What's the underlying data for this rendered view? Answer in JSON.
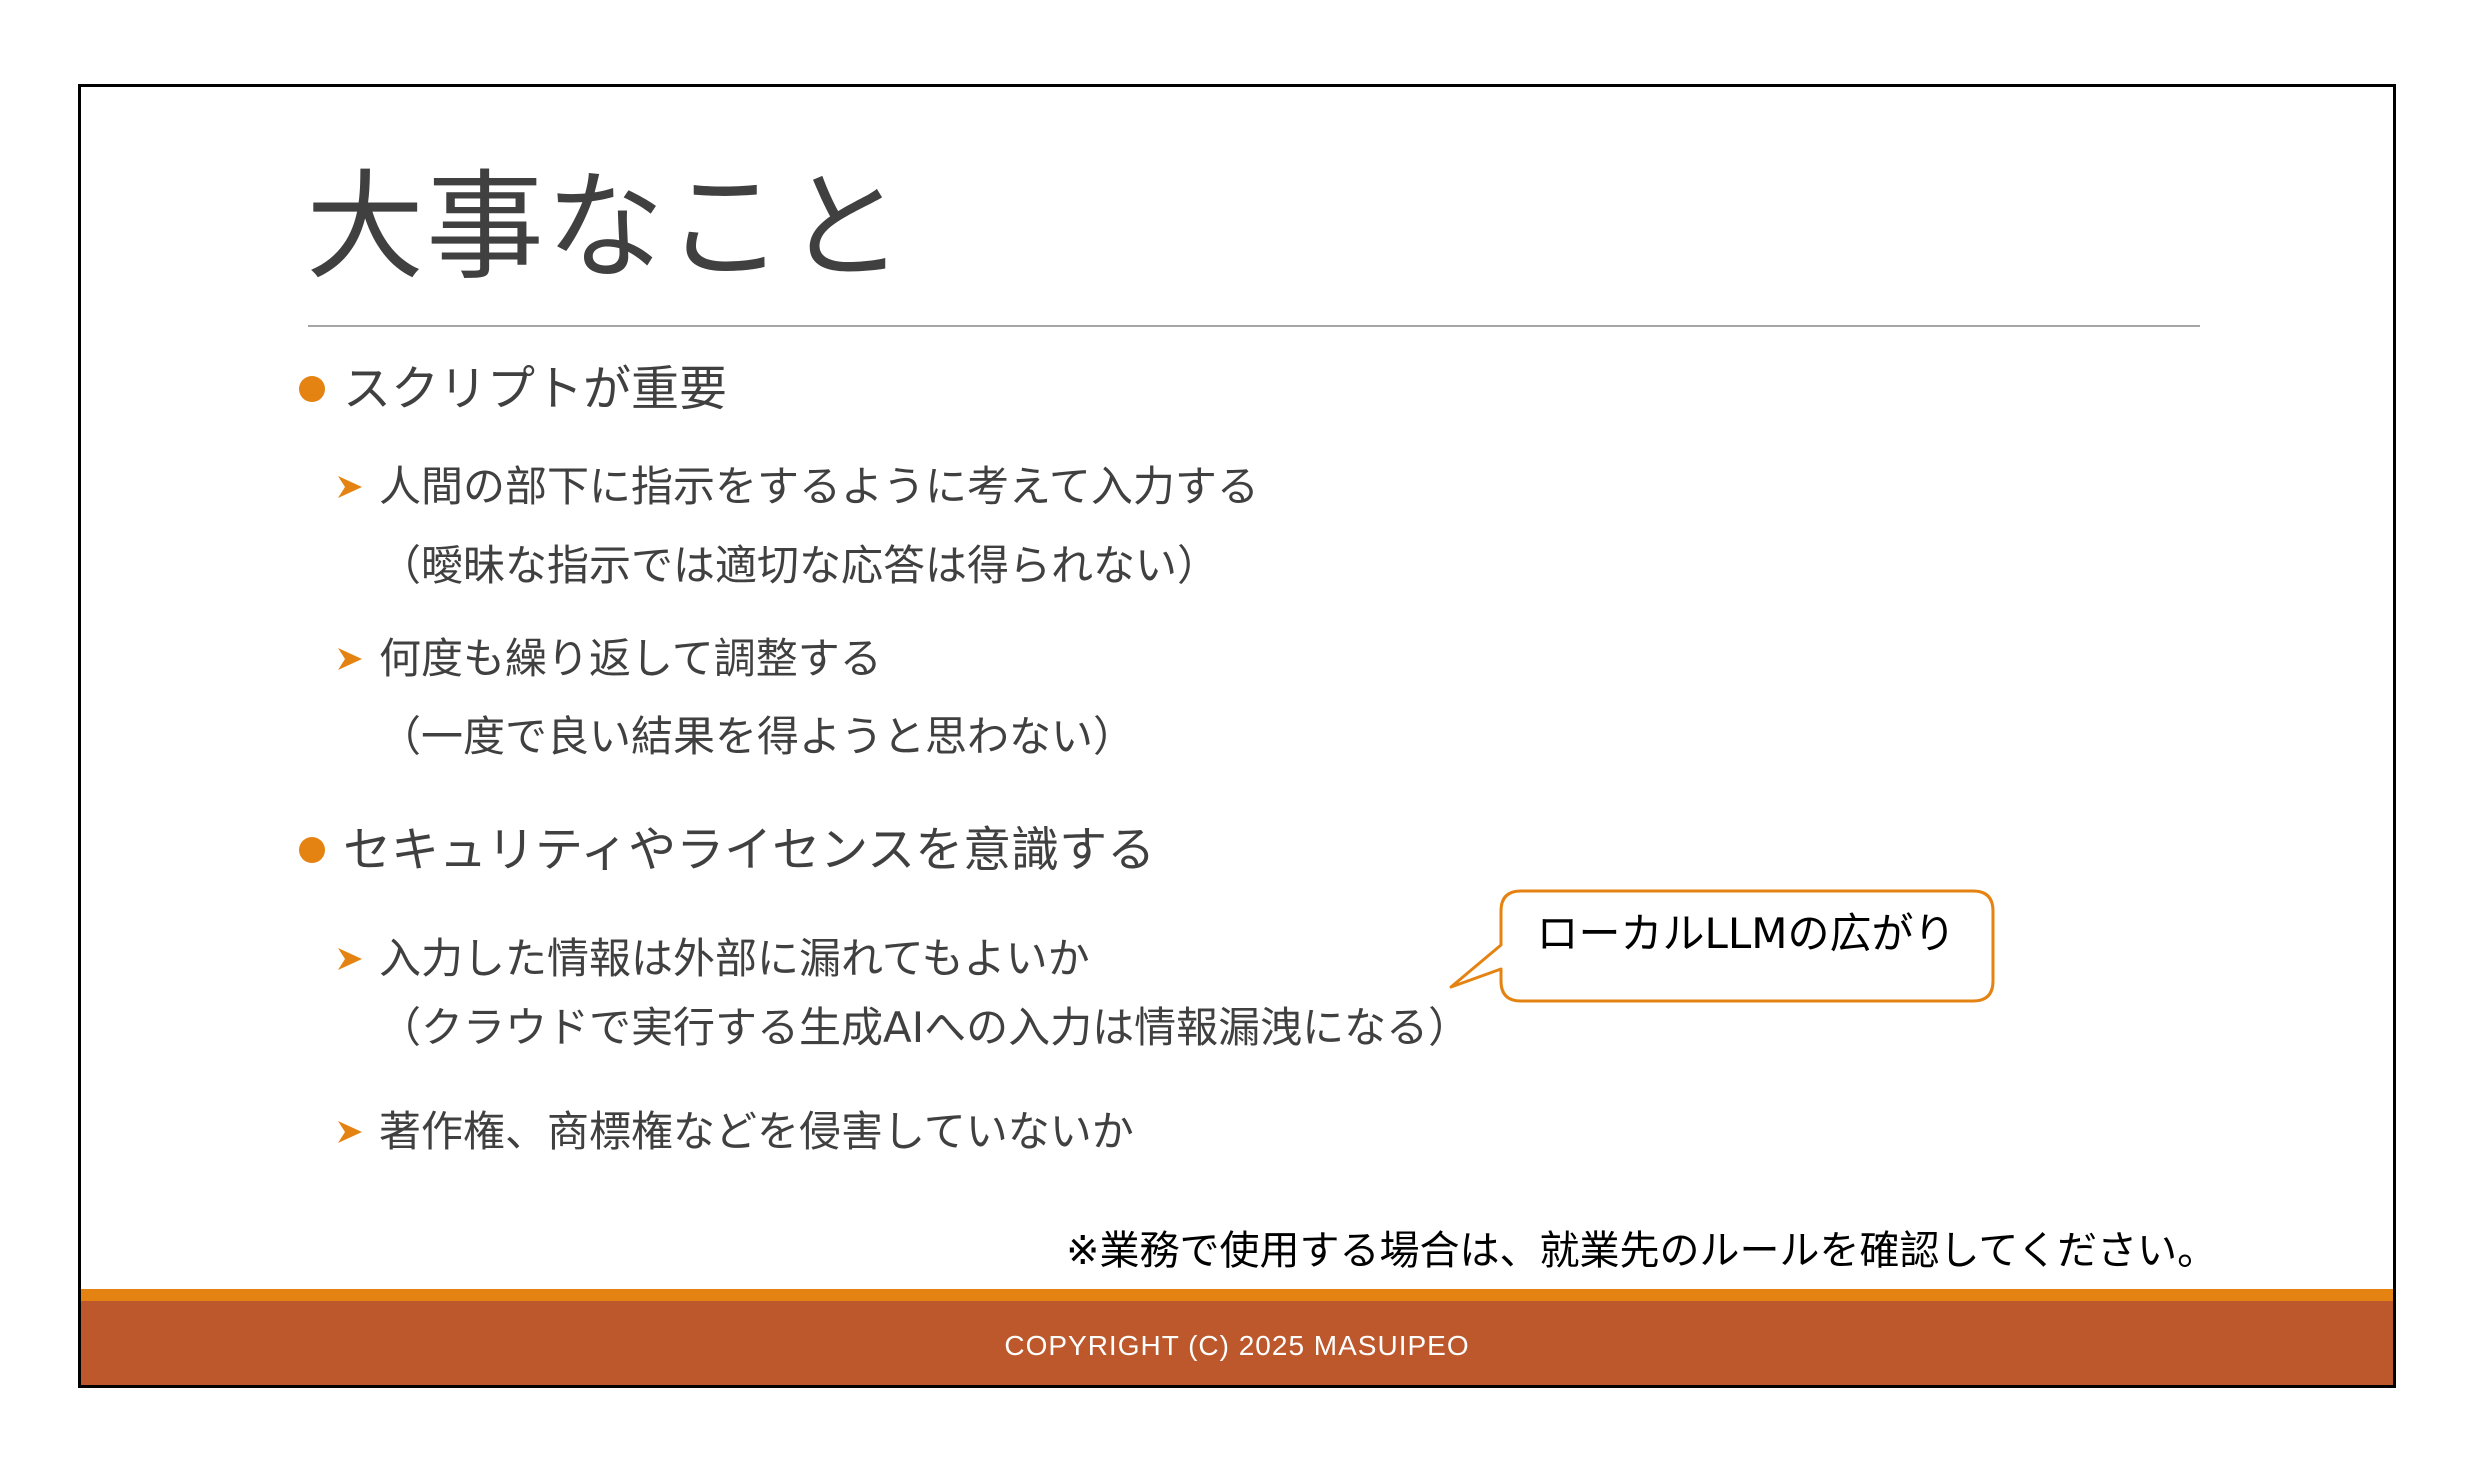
{
  "slide": {
    "title": "大事なこと",
    "sections": [
      {
        "bullet": "スクリプトが重要",
        "items": [
          {
            "text": "人間の部下に指示をするように考えて入力する",
            "paren": "（曖昧な指示では適切な応答は得られない）"
          },
          {
            "text": "何度も繰り返して調整する",
            "paren": "（一度で良い結果を得ようと思わない）"
          }
        ]
      },
      {
        "bullet": "セキュリティやライセンスを意識する",
        "items": [
          {
            "text": "入力した情報は外部に漏れてもよいか",
            "paren": "（クラウドで実行する生成AIへの入力は情報漏洩になる）"
          },
          {
            "text": "著作権、商標権などを侵害していないか"
          }
        ]
      }
    ],
    "callout": "ローカルLLMの広がり",
    "note": "※業務で使用する場合は、就業先のルールを確認してください。",
    "footer": "COPYRIGHT (C) 2025 MASUIPEO"
  },
  "colors": {
    "accent": "#e48312",
    "footer_bg": "#bd582c",
    "text": "#404040",
    "rule": "#a6a6a6"
  },
  "icons": {
    "level1_bullet": "orange-dot-icon",
    "level2_bullet": "orange-arrowhead-icon"
  }
}
